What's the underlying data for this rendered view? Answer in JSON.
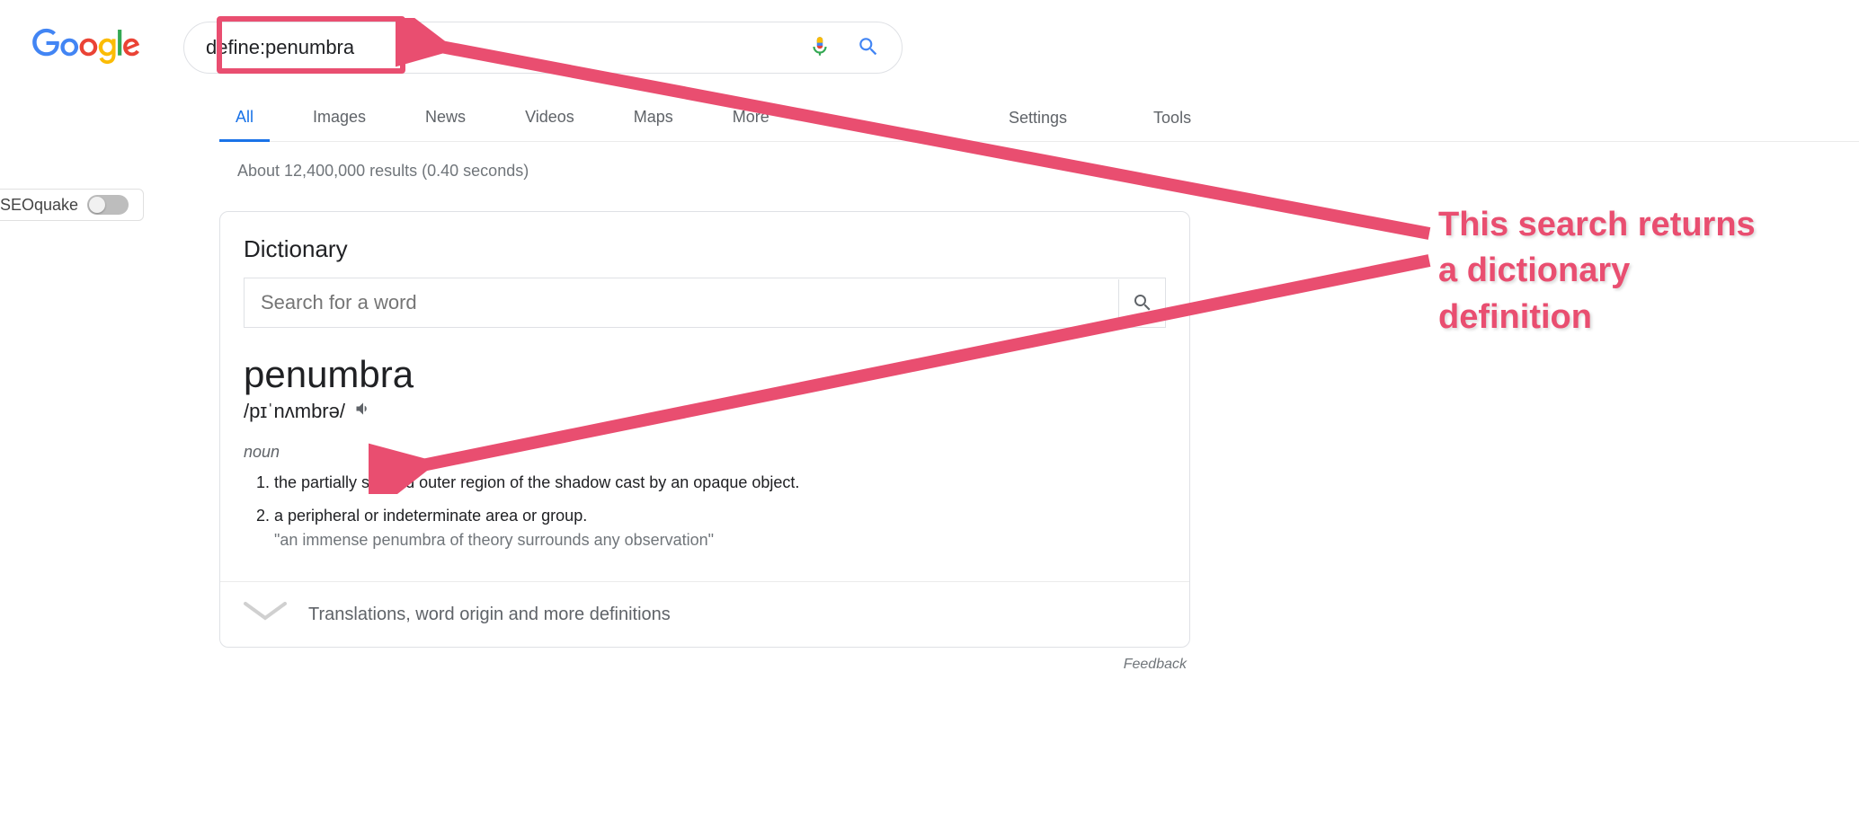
{
  "search": {
    "query": "define:penumbra",
    "placeholder": ""
  },
  "nav": {
    "all": "All",
    "images": "Images",
    "news": "News",
    "videos": "Videos",
    "maps": "Maps",
    "more": "More",
    "settings": "Settings",
    "tools": "Tools"
  },
  "seoquake": {
    "label": "SEOquake"
  },
  "stats": "About 12,400,000 results (0.40 seconds)",
  "dict": {
    "title": "Dictionary",
    "search_placeholder": "Search for a word",
    "word": "penumbra",
    "pronunciation": "/pɪˈnʌmbrə/",
    "pos": "noun",
    "defs": [
      {
        "n": "1.",
        "text": "the partially shaded outer region of the shadow cast by an opaque object."
      },
      {
        "n": "2.",
        "text": "a peripheral or indeterminate area or group.",
        "example": "\"an immense penumbra of theory surrounds any observation\""
      }
    ],
    "expand": "Translations, word origin and more definitions"
  },
  "feedback": "Feedback",
  "annotation": {
    "line1": "This search returns",
    "line2": "a dictionary",
    "line3": "definition"
  }
}
